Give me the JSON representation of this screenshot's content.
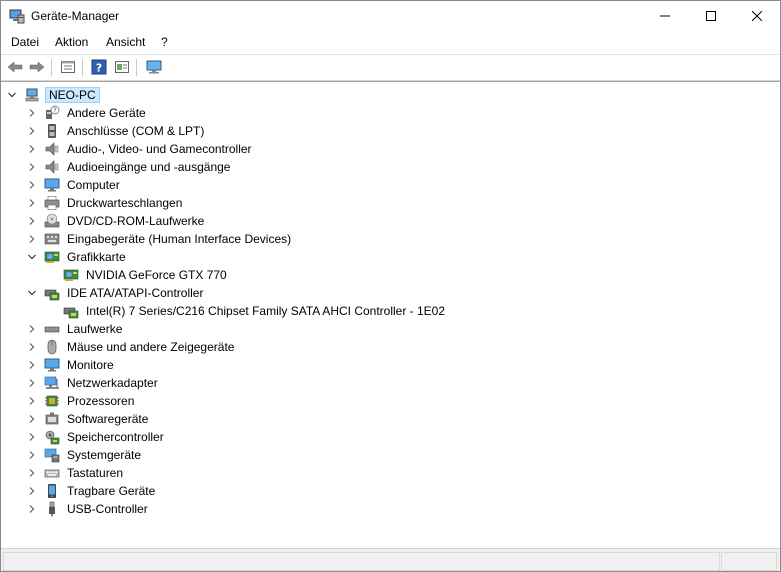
{
  "window": {
    "title": "Geräte-Manager",
    "icon": "device-manager-icon",
    "controls": [
      "minimize-icon",
      "maximize-icon",
      "close-icon"
    ]
  },
  "menu": {
    "datei": "Datei",
    "aktion": "Aktion",
    "ansicht": "Ansicht",
    "help": "?"
  },
  "toolbar": {
    "buttons": [
      "back-arrow-icon",
      "forward-arrow-icon",
      "properties-icon",
      "help-icon",
      "update-driver-icon",
      "scan-hardware-icon"
    ]
  },
  "tree": {
    "root": {
      "label": "NEO-PC",
      "icon": "computer-icon",
      "expanded": true
    },
    "items": [
      {
        "label": "Andere Geräte",
        "icon": "unknown-device-icon",
        "expanded": false
      },
      {
        "label": "Anschlüsse (COM & LPT)",
        "icon": "port-icon",
        "expanded": false
      },
      {
        "label": "Audio-, Video- und Gamecontroller",
        "icon": "speaker-icon",
        "expanded": false
      },
      {
        "label": "Audioeingänge und -ausgänge",
        "icon": "speaker-icon",
        "expanded": false
      },
      {
        "label": "Computer",
        "icon": "monitor-icon",
        "expanded": false
      },
      {
        "label": "Druckwarteschlangen",
        "icon": "printer-icon",
        "expanded": false
      },
      {
        "label": "DVD/CD-ROM-Laufwerke",
        "icon": "disc-drive-icon",
        "expanded": false
      },
      {
        "label": "Eingabegeräte (Human Interface Devices)",
        "icon": "hid-icon",
        "expanded": false
      },
      {
        "label": "Grafikkarte",
        "icon": "display-adapter-icon",
        "expanded": true,
        "children": [
          {
            "label": "NVIDIA GeForce GTX 770",
            "icon": "display-adapter-icon"
          }
        ]
      },
      {
        "label": "IDE ATA/ATAPI-Controller",
        "icon": "ide-controller-icon",
        "expanded": true,
        "children": [
          {
            "label": "Intel(R) 7 Series/C216 Chipset Family SATA AHCI Controller - 1E02",
            "icon": "ide-controller-icon"
          }
        ]
      },
      {
        "label": "Laufwerke",
        "icon": "disk-drive-icon",
        "expanded": false
      },
      {
        "label": "Mäuse und andere Zeigegeräte",
        "icon": "mouse-icon",
        "expanded": false
      },
      {
        "label": "Monitore",
        "icon": "monitor-icon",
        "expanded": false
      },
      {
        "label": "Netzwerkadapter",
        "icon": "network-adapter-icon",
        "expanded": false
      },
      {
        "label": "Prozessoren",
        "icon": "processor-icon",
        "expanded": false
      },
      {
        "label": "Softwaregeräte",
        "icon": "software-device-icon",
        "expanded": false
      },
      {
        "label": "Speichercontroller",
        "icon": "storage-controller-icon",
        "expanded": false
      },
      {
        "label": "Systemgeräte",
        "icon": "system-device-icon",
        "expanded": false
      },
      {
        "label": "Tastaturen",
        "icon": "keyboard-icon",
        "expanded": false
      },
      {
        "label": "Tragbare Geräte",
        "icon": "portable-device-icon",
        "expanded": false
      },
      {
        "label": "USB-Controller",
        "icon": "usb-icon",
        "expanded": false
      }
    ]
  }
}
